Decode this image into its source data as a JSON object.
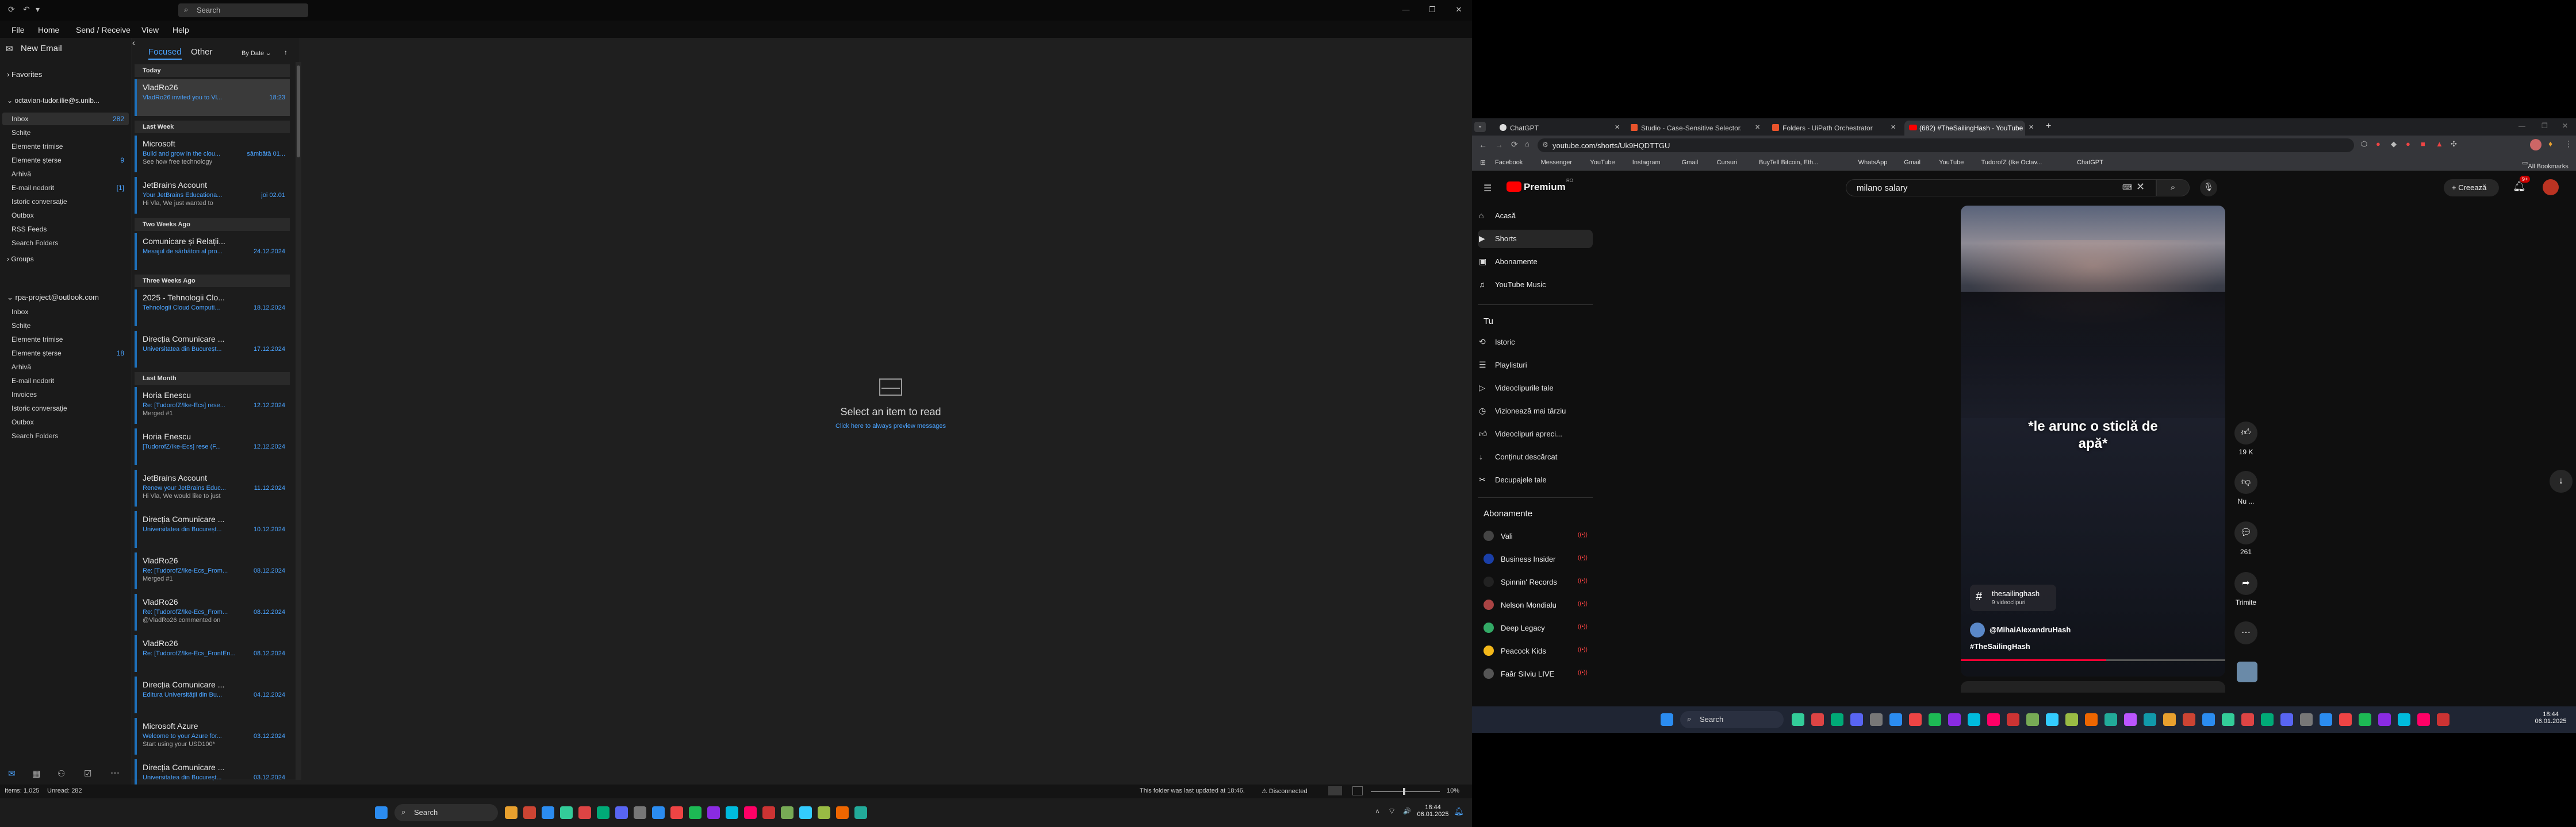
{
  "outlook": {
    "search_placeholder": "Search",
    "menu": [
      "File",
      "Home",
      "Send / Receive",
      "View",
      "Help"
    ],
    "new_email": "New Email",
    "favorites": "Favorites",
    "account1": "octavian-tudor.ilie@s.unib...",
    "account1_folders": [
      {
        "name": "Inbox",
        "count": "282"
      },
      {
        "name": "Schițe",
        "count": ""
      },
      {
        "name": "Elemente trimise",
        "count": ""
      },
      {
        "name": "Elemente șterse",
        "count": "9"
      },
      {
        "name": "Arhivă",
        "count": ""
      },
      {
        "name": "E-mail nedorit",
        "count": "[1]"
      },
      {
        "name": "Istoric conversație",
        "count": ""
      },
      {
        "name": "Outbox",
        "count": ""
      },
      {
        "name": "RSS Feeds",
        "count": ""
      },
      {
        "name": "Search Folders",
        "count": ""
      }
    ],
    "groups": "Groups",
    "account2": "rpa-project@outlook.com",
    "account2_folders": [
      {
        "name": "Inbox",
        "count": ""
      },
      {
        "name": "Schițe",
        "count": ""
      },
      {
        "name": "Elemente trimise",
        "count": ""
      },
      {
        "name": "Elemente șterse",
        "count": "18"
      },
      {
        "name": "Arhivă",
        "count": ""
      },
      {
        "name": "E-mail nedorit",
        "count": ""
      },
      {
        "name": "Invoices",
        "count": ""
      },
      {
        "name": "Istoric conversație",
        "count": ""
      },
      {
        "name": "Outbox",
        "count": ""
      },
      {
        "name": "Search Folders",
        "count": ""
      }
    ],
    "tab_focused": "Focused",
    "tab_other": "Other",
    "sort_label": "By Date",
    "groups_list": [
      {
        "label": "Today",
        "messages": [
          {
            "sender": "VladRo26",
            "preview": "VladRo26 invited you to Vl...",
            "preview2": "",
            "date": "18:23",
            "selected": true
          }
        ]
      },
      {
        "label": "Last Week",
        "messages": [
          {
            "sender": "Microsoft",
            "preview": "Build and grow in the clou...",
            "preview2": "See how free technology",
            "date": "sâmbătă 01..."
          },
          {
            "sender": "JetBrains Account",
            "preview": "Your JetBrains Educationa...",
            "preview2": "Hi Vla,  We just wanted to",
            "date": "joi 02.01"
          }
        ]
      },
      {
        "label": "Two Weeks Ago",
        "messages": [
          {
            "sender": "Comunicare și Relații...",
            "preview": "Mesajul de sărbători al pro...",
            "preview2": "",
            "date": "24.12.2024"
          }
        ]
      },
      {
        "label": "Three Weeks Ago",
        "messages": [
          {
            "sender": "2025 - Tehnologii Clo...",
            "preview": "Tehnologii Cloud Computi...",
            "preview2": "",
            "date": "18.12.2024"
          },
          {
            "sender": "Direcția Comunicare ...",
            "preview": "Universitatea din Bucureșt...",
            "preview2": "",
            "date": "17.12.2024"
          }
        ]
      },
      {
        "label": "Last Month",
        "messages": [
          {
            "sender": "Horia Enescu",
            "preview": "Re: [TudorofZ/Ike-Ecs] rese...",
            "preview2": "Merged #1",
            "date": "12.12.2024"
          },
          {
            "sender": "Horia Enescu",
            "preview": "[TudorofZ/Ike-Ecs] rese (F...",
            "preview2": "",
            "date": "12.12.2024"
          },
          {
            "sender": "JetBrains Account",
            "preview": "Renew your JetBrains Educ...",
            "preview2": "Hi Vla,  We would like to just",
            "date": "11.12.2024"
          },
          {
            "sender": "Direcția Comunicare ...",
            "preview": "Universitatea din Bucureșt...",
            "preview2": "",
            "date": "10.12.2024"
          },
          {
            "sender": "VladRo26",
            "preview": "Re: [TudorofZ/Ike-Ecs_From...",
            "preview2": "Merged #1",
            "date": "08.12.2024"
          },
          {
            "sender": "VladRo26",
            "preview": "Re: [TudorofZ/Ike-Ecs_From...",
            "preview2": "@VladRo26 commented on",
            "date": "08.12.2024"
          },
          {
            "sender": "VladRo26",
            "preview": "Re: [TudorofZ/Ike-Ecs_FrontEn...",
            "preview2": "",
            "date": "08.12.2024"
          },
          {
            "sender": "Direcția Comunicare ...",
            "preview": "Editura Universității din Bu...",
            "preview2": "",
            "date": "04.12.2024"
          },
          {
            "sender": "Microsoft Azure",
            "preview": "Welcome to your Azure for...",
            "preview2": "Start using your USD100*",
            "date": "03.12.2024"
          },
          {
            "sender": "Direcția Comunicare ...",
            "preview": "Universitatea din Bucureșt...",
            "preview2": "",
            "date": "03.12.2024"
          }
        ]
      }
    ],
    "reading_title": "Select an item to read",
    "reading_link": "Click here to always preview messages",
    "status_items": "Items: 1,025",
    "status_unread": "Unread: 282",
    "status_updated": "This folder was last updated at 18:46.",
    "status_disconnected": "Disconnected",
    "status_zoom": "10%"
  },
  "taskbar1": {
    "search": "Search",
    "time": "18:44",
    "date": "06.01.2025",
    "lang": "ENG"
  },
  "taskbar2": {
    "search": "Search",
    "time": "18:44",
    "date": "06.01.2025"
  },
  "chrome": {
    "tabs": [
      {
        "title": "ChatGPT"
      },
      {
        "title": "Studio - Case-Sensitive Selector..."
      },
      {
        "title": "Folders - UiPath Orchestrator"
      },
      {
        "title": "(682) #TheSailingHash - YouTube"
      }
    ],
    "url": "youtube.com/shorts/Uk9HQDTTGU",
    "bookmarks": [
      "Facebook",
      "Messenger",
      "YouTube",
      "Instagram",
      "Gmail",
      "Cursuri",
      "BuyTell Bitcoin, Eth...",
      "WhatsApp",
      "Gmail",
      "YouTube",
      "TudorofZ (Ike Octav...",
      "ChatGPT"
    ],
    "all_bookmarks": "All Bookmarks"
  },
  "youtube": {
    "logo": "Premium",
    "logo_sup": "RO",
    "search_value": "milano salary",
    "create": "Creează",
    "notifications": "9+",
    "nav": [
      "Acasă",
      "Shorts",
      "Abonamente",
      "YouTube Music"
    ],
    "you_label": "Tu",
    "you_items": [
      "Istoric",
      "Playlisturi",
      "Videoclipurile tale",
      "Vizionează mai târziu",
      "Videoclipuri apreci...",
      "Conținut descărcat",
      "Decupajele tale"
    ],
    "subs_label": "Abonamente",
    "subs": [
      "Vali",
      "Business Insider",
      "Spinnin' Records",
      "Nelson Mondialu",
      "Deep Legacy",
      "Peacock Kids",
      "Faăr Silviu LIVE"
    ],
    "overlay_text": "*le arunc o sticlă de apă*",
    "hashtag_name": "thesailinghash",
    "hashtag_count": "9 videoclipuri",
    "channel": "@MihaiAlexandruHash",
    "caption": "#TheSailingHash",
    "likes": "19 K",
    "dislike": "Nu ...",
    "comments": "261",
    "share": "Trimite"
  }
}
